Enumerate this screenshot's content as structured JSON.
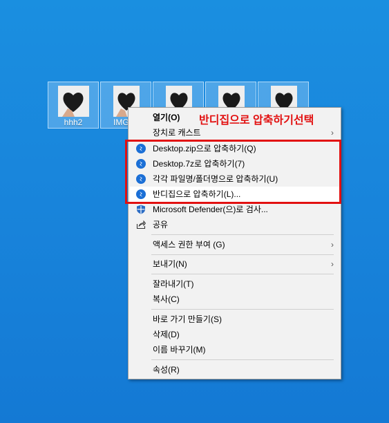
{
  "desktop": {
    "icons": [
      {
        "label": "hhh2"
      },
      {
        "label": "IMG_4"
      },
      {
        "label": ""
      },
      {
        "label": ""
      },
      {
        "label": ""
      }
    ]
  },
  "annotation": "반디집으로 압축하기선택",
  "menu": {
    "open": "열기(O)",
    "cast": "장치로 캐스트",
    "zip": "Desktop.zip으로 압축하기(Q)",
    "sevenz": "Desktop.7z로 압축하기(7)",
    "each": "각각 파일명/폴더명으로 압축하기(U)",
    "bandizip": "반디집으로 압축하기(L)...",
    "defender": "Microsoft Defender(으)로 검사...",
    "share": "공유",
    "access": "액세스 권한 부여 (G)",
    "sendto": "보내기(N)",
    "cut": "잘라내기(T)",
    "copy": "복사(C)",
    "shortcut": "바로 가기 만들기(S)",
    "delete": "삭제(D)",
    "rename": "이름 바꾸기(M)",
    "properties": "속성(R)"
  },
  "colors": {
    "annotation_red": "#e21010",
    "bandizip_blue": "#1b6fd6",
    "desktop_blue": "#1986dc"
  },
  "icons": {
    "bandizip": "bandizip-icon",
    "defender": "shield-icon",
    "share": "share-icon",
    "submenu": "chevron-right-icon"
  }
}
